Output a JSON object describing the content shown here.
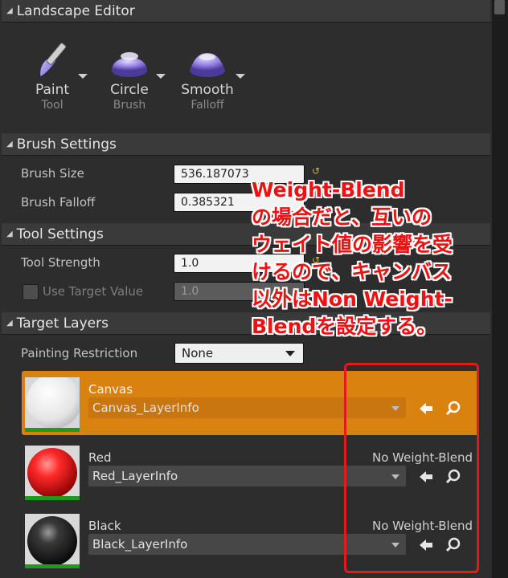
{
  "panel": {
    "title": "Landscape Editor"
  },
  "toolbar": {
    "items": [
      {
        "title": "Paint",
        "subtitle": "Tool",
        "icon": "paintbrush-icon"
      },
      {
        "title": "Circle",
        "subtitle": "Brush",
        "icon": "circle-brush-icon"
      },
      {
        "title": "Smooth",
        "subtitle": "Falloff",
        "icon": "smooth-falloff-icon"
      }
    ]
  },
  "brush_settings": {
    "header": "Brush Settings",
    "brush_size_label": "Brush Size",
    "brush_size_value": "536.187073",
    "brush_falloff_label": "Brush Falloff",
    "brush_falloff_value": "0.385321"
  },
  "tool_settings": {
    "header": "Tool Settings",
    "tool_strength_label": "Tool Strength",
    "tool_strength_value": "1.0",
    "use_target_label": "Use Target Value",
    "use_target_value": "1.0"
  },
  "target_layers": {
    "header": "Target Layers",
    "painting_restriction_label": "Painting Restriction",
    "painting_restriction_value": "None",
    "layers": [
      {
        "name": "Canvas",
        "info": "Canvas_LayerInfo",
        "blend": "",
        "selected": true
      },
      {
        "name": "Red",
        "info": "Red_LayerInfo",
        "blend": "No Weight-Blend",
        "selected": false
      },
      {
        "name": "Black",
        "info": "Black_LayerInfo",
        "blend": "No Weight-Blend",
        "selected": false
      }
    ]
  },
  "annotation": {
    "text": "Weight-Blend\nの場合だと、互いの\nウェイト値の影響を受\nけるので、キャンバス\n以外はNon Weight-\nBlendを設定する。"
  },
  "colors": {
    "selected_row": "#d9820f",
    "annotation": "#ee1111",
    "accent_purple": "#8f7be0"
  }
}
